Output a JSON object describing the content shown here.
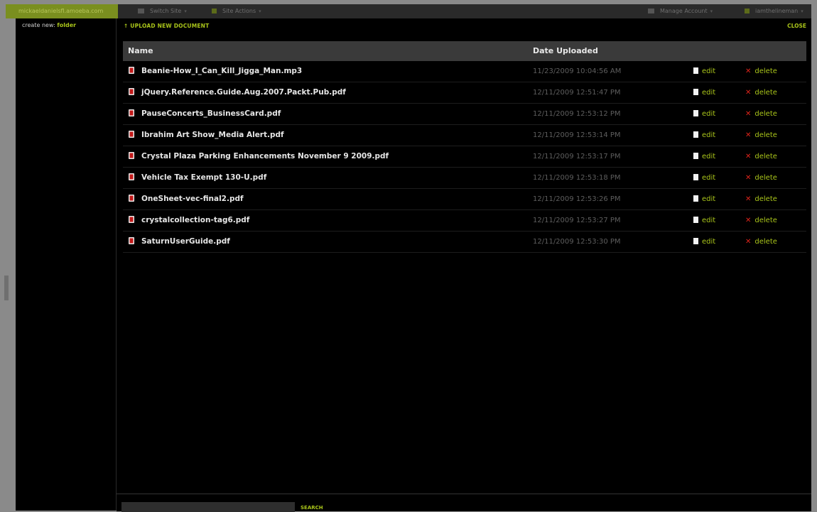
{
  "topbar": {
    "site_name": "mickaeldanielsfl.amoeba.com",
    "switch_site": "Switch Site",
    "site_actions": "Site Actions",
    "manage_account": "Manage Account",
    "user": "iamthelineman"
  },
  "sidebar": {
    "create_new_label": "create new:",
    "folder_link": "folder"
  },
  "main": {
    "upload_label": "↑ UPLOAD NEW DOCUMENT",
    "close_label": "CLOSE",
    "columns": {
      "name": "Name",
      "date": "Date Uploaded"
    },
    "files": [
      {
        "name": "Beanie-How_I_Can_Kill_Jigga_Man.mp3",
        "date": "11/23/2009 10:04:56 AM",
        "edit": "edit",
        "delete": "delete"
      },
      {
        "name": "jQuery.Reference.Guide.Aug.2007.Packt.Pub.pdf",
        "date": "12/11/2009 12:51:47 PM",
        "edit": "edit",
        "delete": "delete"
      },
      {
        "name": "PauseConcerts_BusinessCard.pdf",
        "date": "12/11/2009 12:53:12 PM",
        "edit": "edit",
        "delete": "delete"
      },
      {
        "name": "Ibrahim Art Show_Media Alert.pdf",
        "date": "12/11/2009 12:53:14 PM",
        "edit": "edit",
        "delete": "delete"
      },
      {
        "name": "Crystal Plaza Parking Enhancements November 9 2009.pdf",
        "date": "12/11/2009 12:53:17 PM",
        "edit": "edit",
        "delete": "delete"
      },
      {
        "name": "Vehicle Tax Exempt 130-U.pdf",
        "date": "12/11/2009 12:53:18 PM",
        "edit": "edit",
        "delete": "delete"
      },
      {
        "name": "OneSheet-vec-final2.pdf",
        "date": "12/11/2009 12:53:26 PM",
        "edit": "edit",
        "delete": "delete"
      },
      {
        "name": "crystalcollection-tag6.pdf",
        "date": "12/11/2009 12:53:27 PM",
        "edit": "edit",
        "delete": "delete"
      },
      {
        "name": "SaturnUserGuide.pdf",
        "date": "12/11/2009 12:53:30 PM",
        "edit": "edit",
        "delete": "delete"
      }
    ],
    "search_label": "SEARCH"
  }
}
